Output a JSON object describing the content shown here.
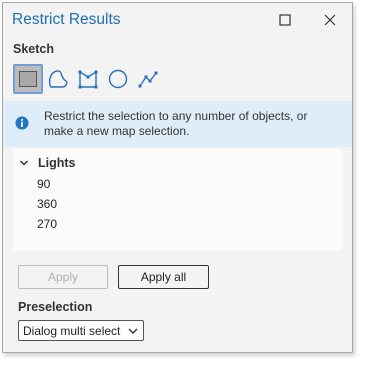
{
  "window": {
    "title": "Restrict Results"
  },
  "sketch": {
    "label": "Sketch",
    "tools": [
      {
        "icon": "rectangle-icon",
        "selected": true
      },
      {
        "icon": "lasso-icon",
        "selected": false
      },
      {
        "icon": "polygon-icon",
        "selected": false
      },
      {
        "icon": "circle-icon",
        "selected": false
      },
      {
        "icon": "line-icon",
        "selected": false
      }
    ]
  },
  "info": {
    "icon": "info-icon",
    "text": "Restrict the selection to any number of objects, or make a new map selection."
  },
  "tree": {
    "group": "Lights",
    "items": [
      "90",
      "360",
      "270"
    ]
  },
  "buttons": {
    "apply": "Apply",
    "apply_all": "Apply all"
  },
  "preselection": {
    "label": "Preselection",
    "selected": "Dialog multi select"
  },
  "colors": {
    "accent": "#1c6fb5",
    "info_bg": "#dfedf8",
    "selected_border": "#6f9fd4"
  }
}
